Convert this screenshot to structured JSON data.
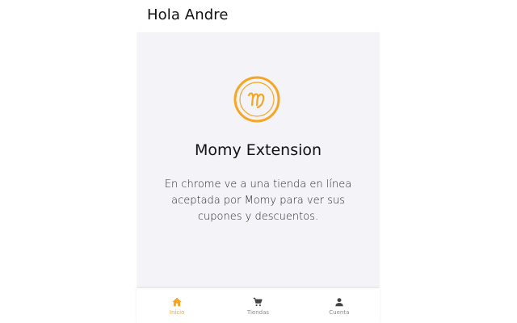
{
  "header": {
    "greeting": "Hola Andre"
  },
  "main": {
    "title": "Momy Extension",
    "description": "En chrome ve a una tienda en línea aceptada por Momy para ver sus cupones y descuentos.",
    "logo_icon": "momy-logo-icon"
  },
  "bottom_nav": {
    "items": [
      {
        "label": "Inicio",
        "icon": "home-icon",
        "active": true
      },
      {
        "label": "Tiendas",
        "icon": "cart-icon",
        "active": false
      },
      {
        "label": "Cuenta",
        "icon": "user-icon",
        "active": false
      }
    ]
  },
  "colors": {
    "accent": "#f5a623",
    "content_background": "#f3f3f8",
    "inactive": "#8a8a8a"
  }
}
